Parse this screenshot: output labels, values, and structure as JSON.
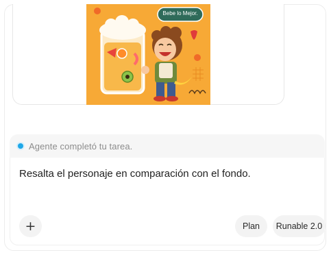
{
  "result_card": {
    "image": {
      "badge_text": "Bebe lo Mejor.",
      "background_color": "#f7a936"
    }
  },
  "status": {
    "text": "Agente completó tu tarea.",
    "dot_color": "#1ea7e8"
  },
  "composer": {
    "prompt_text": "Resalta el personaje en comparación con el fondo.",
    "add_icon": "plus-icon",
    "plan_label": "Plan",
    "model_label": "Runable 2.0"
  }
}
